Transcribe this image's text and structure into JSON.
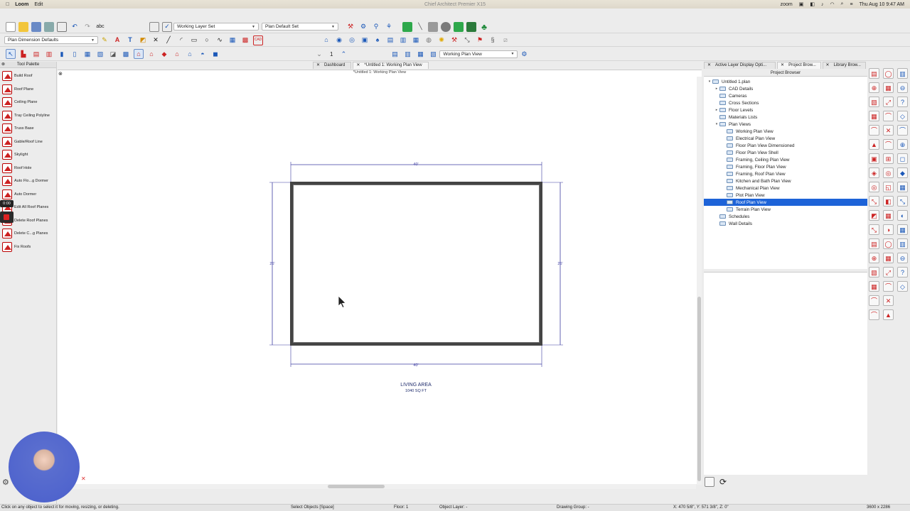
{
  "menubar": {
    "apple": "",
    "app": "Loom",
    "edit": "Edit",
    "window_title": "Chief Architect Premier X15",
    "zoom_label": "zoom",
    "datetime": "Thu Aug 10  9:47 AM"
  },
  "toolbar1": {
    "layer_set": "Working Layer Set",
    "plan_default_set": "Plan Default Set"
  },
  "toolbar2": {
    "dimension_defaults": "Plan Dimension Defaults"
  },
  "toolbar3": {
    "floor_number": "1",
    "plan_view": "Working Plan View"
  },
  "palette": {
    "title": "Tool Palette",
    "items": [
      {
        "label": "Build Roof"
      },
      {
        "label": "Roof Plane"
      },
      {
        "label": "Ceiling Plane"
      },
      {
        "label": "Tray Ceiling Polyline"
      },
      {
        "label": "Truss Base"
      },
      {
        "label": "Gable/Roof Line"
      },
      {
        "label": "Skylight"
      },
      {
        "label": "Roof Hole"
      },
      {
        "label": "Auto Flo...g Dormer"
      },
      {
        "label": "Auto Dormer"
      },
      {
        "label": "Edit All Roof Planes"
      },
      {
        "label": "Delete Roof Planes"
      },
      {
        "label": "Delete C...g Planes"
      },
      {
        "label": "Fix Roofs"
      }
    ]
  },
  "recorder": {
    "timer": "0:00"
  },
  "tabs": [
    {
      "label": "Dashboard"
    },
    {
      "label": "*Untitled 1:  Working Plan View"
    }
  ],
  "canvas": {
    "title": "*Untitled 1:  Working Plan View",
    "dim_top": "40'",
    "dim_bottom": "40'",
    "dim_left": "26'",
    "dim_right": "26'",
    "room_name": "LIVING AREA",
    "room_area": "1040 SQ FT"
  },
  "right_tabs": [
    {
      "label": "Active Layer Display Opti..."
    },
    {
      "label": "Project Brow..."
    },
    {
      "label": "Library Brow..."
    }
  ],
  "project": {
    "title": "Project Browser",
    "tree": [
      {
        "label": "Untitled 1.plan",
        "indent": 0,
        "arrow": "▾"
      },
      {
        "label": "CAD Details",
        "indent": 1,
        "arrow": "▸"
      },
      {
        "label": "Cameras",
        "indent": 1,
        "arrow": ""
      },
      {
        "label": "Cross Sections",
        "indent": 1,
        "arrow": ""
      },
      {
        "label": "Floor Levels",
        "indent": 1,
        "arrow": "▸"
      },
      {
        "label": "Materials Lists",
        "indent": 1,
        "arrow": ""
      },
      {
        "label": "Plan Views",
        "indent": 1,
        "arrow": "▾"
      },
      {
        "label": "Working Plan View",
        "indent": 2,
        "arrow": ""
      },
      {
        "label": "Electrical Plan View",
        "indent": 2,
        "arrow": ""
      },
      {
        "label": "Floor Plan View Dimensioned",
        "indent": 2,
        "arrow": ""
      },
      {
        "label": "Floor Plan View Shell",
        "indent": 2,
        "arrow": ""
      },
      {
        "label": "Framing, Ceiling Plan View",
        "indent": 2,
        "arrow": ""
      },
      {
        "label": "Framing, Floor Plan View",
        "indent": 2,
        "arrow": ""
      },
      {
        "label": "Framing, Roof Plan View",
        "indent": 2,
        "arrow": ""
      },
      {
        "label": "Kitchen and Bath Plan View",
        "indent": 2,
        "arrow": ""
      },
      {
        "label": "Mechanical Plan View",
        "indent": 2,
        "arrow": ""
      },
      {
        "label": "Plot Plan View",
        "indent": 2,
        "arrow": ""
      },
      {
        "label": "Roof Plan View",
        "indent": 2,
        "arrow": "",
        "selected": true
      },
      {
        "label": "Terrain Plan View",
        "indent": 2,
        "arrow": ""
      },
      {
        "label": "Schedules",
        "indent": 1,
        "arrow": ""
      },
      {
        "label": "Wall Details",
        "indent": 1,
        "arrow": ""
      }
    ]
  },
  "status": {
    "hint": "Click on any object to select it for moving, resizing, or deleting.",
    "mode": "Select Objects [Space]",
    "floor": "Floor: 1",
    "object_layer": "Object Layer: -",
    "drawing_group": "Drawing Group: -",
    "coords": "X: 470 5/8\", Y: 571 3/8\", Z: 0\"",
    "resolution": "3600 x 2286"
  },
  "colors": {
    "selection": "#1d63d8",
    "dimension_line": "#3c3ca0",
    "wall": "#444444",
    "tool_red": "#cc2222"
  }
}
